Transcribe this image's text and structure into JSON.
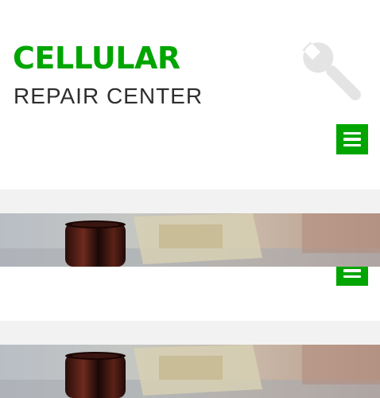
{
  "header": {
    "title": "CELLULAR",
    "subtitle": "REPAIR CENTER",
    "title_color": "#00a500",
    "logo_icon": "wrench-icon",
    "menu_icon": "hamburger-menu-icon"
  },
  "colors": {
    "accent": "#00a500",
    "band": "#f2f2f2",
    "icon_gray": "#e4e4e4"
  }
}
